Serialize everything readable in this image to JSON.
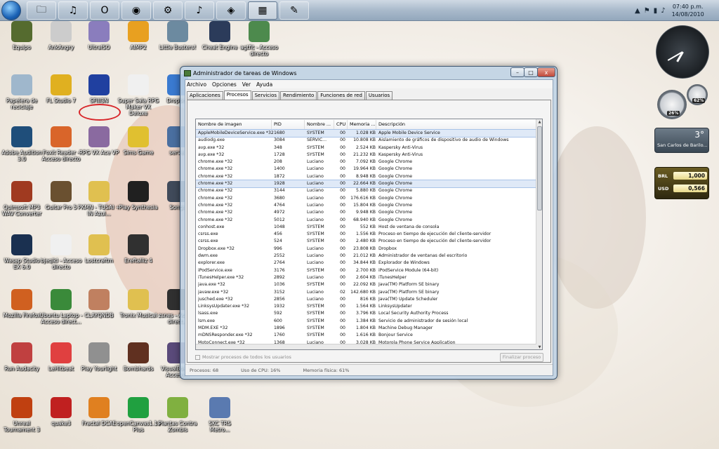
{
  "taskbar": {
    "pinned_icons": [
      "explorer-icon",
      "media-icon",
      "opera-icon",
      "chrome-icon",
      "network-icon",
      "itunes-icon",
      "cs-icon",
      "taskmanager-icon",
      "paint-icon"
    ],
    "clock": {
      "time": "07:40 p.m.",
      "date": "14/08/2010"
    }
  },
  "desktop": {
    "icons": [
      {
        "label": "Equipo",
        "icon": "computer-icon",
        "color": "#556b2f"
      },
      {
        "label": "AnkAngry",
        "icon": "app-icon",
        "color": "#cccccc"
      },
      {
        "label": "UltraISO",
        "icon": "disc-icon",
        "color": "#8a7dbd"
      },
      {
        "label": "AIMP2",
        "icon": "audio-icon",
        "color": "#e8a020"
      },
      {
        "label": "Little Busters!",
        "icon": "game-icon",
        "color": "#6c8aa0"
      },
      {
        "label": "Cheat Engine",
        "icon": "engine-icon",
        "color": "#2b3b5a"
      },
      {
        "label": "agtfit - Acceso directo",
        "icon": "shortcut-icon",
        "color": "#4d8a4d"
      },
      {
        "label": "Papelera de reciclaje",
        "icon": "recycle-bin-icon",
        "color": "#9fb7cc"
      },
      {
        "label": "FL Studio 7",
        "icon": "fl-studio-icon",
        "color": "#e0b020"
      },
      {
        "label": "SFIII3N",
        "icon": "game-icon",
        "color": "#2040a0"
      },
      {
        "label": "Super Sala RPG Maker VX Deluxe",
        "icon": "document-icon",
        "color": "#f0f0f0"
      },
      {
        "label": "Dropbox",
        "icon": "dropbox-icon",
        "color": "#3a7ad0"
      },
      {
        "label": "Adobe Audition 3.0",
        "icon": "audition-icon",
        "color": "#1f4e7a"
      },
      {
        "label": "Foxit Reader - Acceso directo",
        "icon": "pdf-icon",
        "color": "#d9652a"
      },
      {
        "label": "RPG VX Ace VP",
        "icon": "rpg-icon",
        "color": "#8a6aa0"
      },
      {
        "label": "Sims Game",
        "icon": "game-icon",
        "color": "#e0c030"
      },
      {
        "label": "server",
        "icon": "server-icon",
        "color": "#4a6fa0"
      },
      {
        "label": "Quimsoft MP3 WAV Converter",
        "icon": "converter-icon",
        "color": "#a03a20"
      },
      {
        "label": "Guitar Pro 5",
        "icon": "guitar-icon",
        "color": "#6a5030"
      },
      {
        "label": "PKMN - TUSAI + IN Azul...",
        "icon": "folder-icon",
        "color": "#e0c050"
      },
      {
        "label": "Play Synthesia",
        "icon": "piano-icon",
        "color": "#202020"
      },
      {
        "label": "Songs",
        "icon": "folder-icon",
        "color": "#404a5a"
      },
      {
        "label": "Wasap Studio EX 6.0",
        "icon": "chat-icon",
        "color": "#1a3050"
      },
      {
        "label": "bjeqikl - Acceso directo",
        "icon": "check-icon",
        "color": "#f0f0f0"
      },
      {
        "label": "Lostcraftm",
        "icon": "folder-icon",
        "color": "#e0c050"
      },
      {
        "label": "Ereftalliz 4",
        "icon": "app-icon",
        "color": "#303030"
      },
      {
        "label": "Mozilla Firefox",
        "icon": "firefox-icon",
        "color": "#d06020"
      },
      {
        "label": "Ubuntu Laptop - Acceso direct...",
        "icon": "shortcut-icon",
        "color": "#3a8a3a"
      },
      {
        "label": "CLAYQNDB",
        "icon": "game-icon",
        "color": "#c08060"
      },
      {
        "label": "Tronix Musical",
        "icon": "folder-icon",
        "color": "#e0c050"
      },
      {
        "label": "zsnes - Acceso direct...",
        "icon": "snes-icon",
        "color": "#303030"
      },
      {
        "label": "Run Audacity",
        "icon": "audacity-icon",
        "color": "#c04040"
      },
      {
        "label": "LeHitbeat",
        "icon": "game-icon",
        "color": "#e04040"
      },
      {
        "label": "Play Yourlight",
        "icon": "game-icon",
        "color": "#909090"
      },
      {
        "label": "Bombhards",
        "icon": "game-icon",
        "color": "#603020"
      },
      {
        "label": "VisualBoy... - Acceso...",
        "icon": "gameboy-icon",
        "color": "#5a4a7a"
      },
      {
        "label": "Unreal Tournament 3",
        "icon": "game-icon",
        "color": "#c04010"
      },
      {
        "label": "quake3",
        "icon": "game-icon",
        "color": "#c02020"
      },
      {
        "label": "Fractal DCAE",
        "icon": "app-icon",
        "color": "#e08020"
      },
      {
        "label": "openCanvas1.1e Plus",
        "icon": "paint-icon",
        "color": "#20a040"
      },
      {
        "label": "Plantas Contra Zombis",
        "icon": "game-icon",
        "color": "#80b040"
      },
      {
        "label": "SKC TRS Metro...",
        "icon": "mp3-file-icon",
        "color": "#5a7ab0"
      }
    ]
  },
  "gadgets": {
    "cpu": {
      "cpu_percent": "26%",
      "mem_percent": "62%"
    },
    "weather": {
      "temp": "3°",
      "city": "San Carlos de Barilo..."
    },
    "currency": [
      {
        "code": "BRL",
        "value": "1,000"
      },
      {
        "code": "USD",
        "value": "0,566"
      }
    ]
  },
  "window": {
    "title": "Administrador de tareas de Windows",
    "minimize": "–",
    "maximize": "□",
    "close": "x",
    "menu": [
      "Archivo",
      "Opciones",
      "Ver",
      "Ayuda"
    ],
    "tabs": [
      "Aplicaciones",
      "Procesos",
      "Servicios",
      "Rendimiento",
      "Funciones de red",
      "Usuarios"
    ],
    "active_tab": "Procesos",
    "columns": [
      "Nombre de imagen",
      "PID",
      "Nombre ...",
      "CPU",
      "Memoria ...",
      "Descripción"
    ],
    "processes": [
      [
        "AppleMobileDeviceService.exe *32",
        "1680",
        "SYSTEM",
        "00",
        "1.028 KB",
        "Apple Mobile Device Service"
      ],
      [
        "audiodg.exe",
        "3084",
        "SERVIC...",
        "00",
        "10.808 KB",
        "Aislamiento de gráficos de dispositivo de audio de Windows"
      ],
      [
        "avp.exe *32",
        "348",
        "SYSTEM",
        "00",
        "2.524 KB",
        "Kaspersky Anti-Virus"
      ],
      [
        "avp.exe *32",
        "1728",
        "SYSTEM",
        "00",
        "21.232 KB",
        "Kaspersky Anti-Virus"
      ],
      [
        "chrome.exe *32",
        "208",
        "Luciano",
        "00",
        "7.092 KB",
        "Google Chrome"
      ],
      [
        "chrome.exe *32",
        "1400",
        "Luciano",
        "00",
        "19.964 KB",
        "Google Chrome"
      ],
      [
        "chrome.exe *32",
        "1872",
        "Luciano",
        "00",
        "8.948 KB",
        "Google Chrome"
      ],
      [
        "chrome.exe *32",
        "1928",
        "Luciano",
        "00",
        "22.664 KB",
        "Google Chrome"
      ],
      [
        "chrome.exe *32",
        "3144",
        "Luciano",
        "00",
        "5.880 KB",
        "Google Chrome"
      ],
      [
        "chrome.exe *32",
        "3680",
        "Luciano",
        "00",
        "176.616 KB",
        "Google Chrome"
      ],
      [
        "chrome.exe *32",
        "4764",
        "Luciano",
        "00",
        "15.804 KB",
        "Google Chrome"
      ],
      [
        "chrome.exe *32",
        "4972",
        "Luciano",
        "00",
        "9.948 KB",
        "Google Chrome"
      ],
      [
        "chrome.exe *32",
        "5012",
        "Luciano",
        "00",
        "68.940 KB",
        "Google Chrome"
      ],
      [
        "conhost.exe",
        "1048",
        "SYSTEM",
        "00",
        "552 KB",
        "Host de ventana de consola"
      ],
      [
        "csrss.exe",
        "456",
        "SYSTEM",
        "00",
        "1.556 KB",
        "Proceso en tiempo de ejecución del cliente-servidor"
      ],
      [
        "csrss.exe",
        "524",
        "SYSTEM",
        "00",
        "2.480 KB",
        "Proceso en tiempo de ejecución del cliente-servidor"
      ],
      [
        "Dropbox.exe *32",
        "996",
        "Luciano",
        "00",
        "23.808 KB",
        "Dropbox"
      ],
      [
        "dwm.exe",
        "2552",
        "Luciano",
        "00",
        "21.012 KB",
        "Administrador de ventanas del escritorio"
      ],
      [
        "explorer.exe",
        "2764",
        "Luciano",
        "00",
        "34.844 KB",
        "Explorador de Windows"
      ],
      [
        "iPodService.exe",
        "3176",
        "SYSTEM",
        "00",
        "2.700 KB",
        "iPodService Module (64-bit)"
      ],
      [
        "iTunesHelper.exe *32",
        "2892",
        "Luciano",
        "00",
        "2.604 KB",
        "iTunesHelper"
      ],
      [
        "java.exe *32",
        "1036",
        "SYSTEM",
        "00",
        "22.092 KB",
        "Java(TM) Platform SE binary"
      ],
      [
        "javaw.exe *32",
        "3152",
        "Luciano",
        "02",
        "142.680 KB",
        "Java(TM) Platform SE binary"
      ],
      [
        "jusched.exe *32",
        "2856",
        "Luciano",
        "00",
        "816 KB",
        "Java(TM) Update Scheduler"
      ],
      [
        "LinksysUpdater.exe *32",
        "1932",
        "SYSTEM",
        "00",
        "1.564 KB",
        "LinksysUpdater"
      ],
      [
        "lsass.exe",
        "592",
        "SYSTEM",
        "00",
        "3.796 KB",
        "Local Security Authority Process"
      ],
      [
        "lsm.exe",
        "600",
        "SYSTEM",
        "00",
        "1.384 KB",
        "Servicio de administrador de sesión local"
      ],
      [
        "MDM.EXE *32",
        "1896",
        "SYSTEM",
        "00",
        "1.804 KB",
        "Machine Debug Manager"
      ],
      [
        "mDNSResponder.exe *32",
        "1760",
        "SYSTEM",
        "00",
        "1.616 KB",
        "Bonjour Service"
      ],
      [
        "MotoConnect.exe *32",
        "1368",
        "Luciano",
        "00",
        "3.028 KB",
        "Motorola Phone Service Application"
      ]
    ],
    "show_all_label": "Mostrar procesos de todos los usuarios",
    "end_process_label": "Finalizar proceso",
    "status": {
      "processes": "Procesos: 68",
      "cpu": "Uso de CPU: 16%",
      "memory": "Memoria física: 61%"
    },
    "highlight_color": "#d8262a"
  }
}
